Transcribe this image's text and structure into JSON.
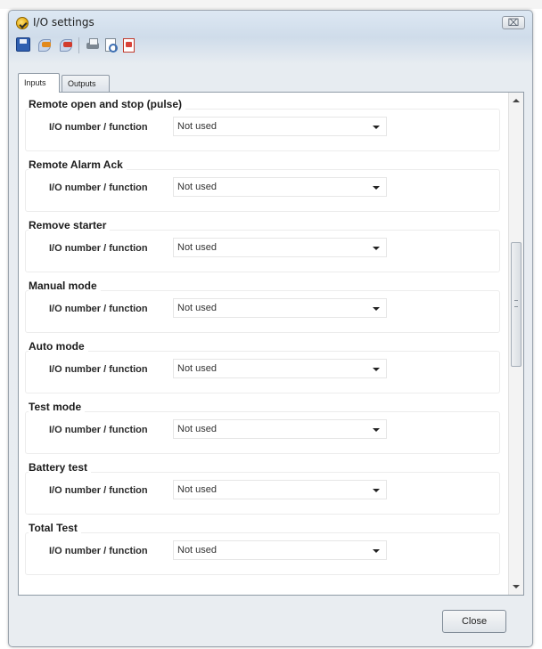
{
  "window": {
    "title": "I/O settings",
    "close_glyph": "⌧"
  },
  "toolbar": [
    {
      "icon": "save-icon"
    },
    {
      "icon": "import-icon"
    },
    {
      "icon": "export-icon"
    },
    {
      "icon": "print-icon"
    },
    {
      "icon": "print-preview-icon"
    },
    {
      "icon": "pdf-icon"
    }
  ],
  "tabs": {
    "inputs": "Inputs",
    "outputs": "Outputs",
    "active": "Inputs"
  },
  "field_label": "I/O number / function",
  "sections": [
    {
      "title": "Remote open and stop (pulse)",
      "value": "Not used"
    },
    {
      "title": "Remote Alarm Ack",
      "value": "Not used"
    },
    {
      "title": "Remove starter",
      "value": "Not used"
    },
    {
      "title": "Manual mode",
      "value": "Not used"
    },
    {
      "title": "Auto mode",
      "value": "Not used"
    },
    {
      "title": "Test mode",
      "value": "Not used"
    },
    {
      "title": "Battery test",
      "value": "Not used"
    },
    {
      "title": "Total Test",
      "value": "Not used"
    }
  ],
  "footer": {
    "close_label": "Close"
  }
}
